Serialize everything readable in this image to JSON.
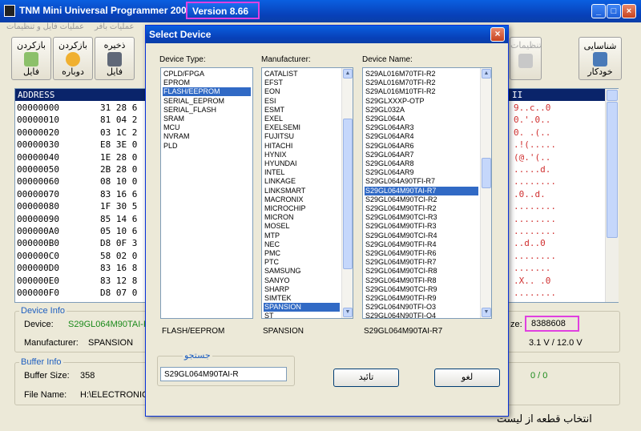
{
  "window": {
    "title": "TNM Mini Universal Programmer 2000+",
    "version": "Version 8.66"
  },
  "menu": {
    "items": [
      "عملیات فایل و تنظیمات",
      "عملیات بافر"
    ]
  },
  "toolbar": {
    "load_file": "بازکردن",
    "load_file2": "فایل",
    "reopen": "بازکردن",
    "reopen2": "دوباره",
    "save": "ذخیره",
    "save2": "فایل",
    "settings": "تنظیمات",
    "detect": "شناسایی",
    "detect2": "خودکار"
  },
  "hex": {
    "header_address": "ADDRESS",
    "header_ascii_tail": "II",
    "rows": [
      {
        "addr": "00000000",
        "hex": "31 28 6",
        "ascii": "9..c..0"
      },
      {
        "addr": "00000010",
        "hex": "81 04 2",
        "ascii": "0.'.0.."
      },
      {
        "addr": "00000020",
        "hex": "03 1C 2",
        "ascii": "0. .(.."
      },
      {
        "addr": "00000030",
        "hex": "E8 3E 0",
        "ascii": ".!(....."
      },
      {
        "addr": "00000040",
        "hex": "1E 28 0",
        "ascii": "(@.'(.."
      },
      {
        "addr": "00000050",
        "hex": "2B 28 0",
        "ascii": ".....d."
      },
      {
        "addr": "00000060",
        "hex": "08 10 0",
        "ascii": "........"
      },
      {
        "addr": "00000070",
        "hex": "83 16 6",
        "ascii": ".0..d."
      },
      {
        "addr": "00000080",
        "hex": "1F 30 5",
        "ascii": "........"
      },
      {
        "addr": "00000090",
        "hex": "85 14 6",
        "ascii": "........"
      },
      {
        "addr": "000000A0",
        "hex": "05 10 6",
        "ascii": "........"
      },
      {
        "addr": "000000B0",
        "hex": "D8 0F 3",
        "ascii": "..d..0"
      },
      {
        "addr": "000000C0",
        "hex": "58 02 0",
        "ascii": "........"
      },
      {
        "addr": "000000D0",
        "hex": "83 16 8",
        "ascii": "......."
      },
      {
        "addr": "000000E0",
        "hex": "83 12 8",
        "ascii": ".X.. .0"
      },
      {
        "addr": "000000F0",
        "hex": "D8 07 0",
        "ascii": "........"
      }
    ]
  },
  "device_info": {
    "group_label": "Device Info",
    "device_label": "Device:",
    "device_value": "S29GL064M90TAI-R",
    "manufacturer_label": "Manufacturer:",
    "manufacturer_value": "SPANSION",
    "size_label": "ze:",
    "size_value": "8388608",
    "voltage_value": "3.1 V / 12.0 V"
  },
  "buffer_info": {
    "group_label": "Buffer Info",
    "buffer_size_label": "Buffer Size:",
    "buffer_size_value": "358",
    "file_name_label": "File Name:",
    "file_name_value": "H:\\ELECTRONIC",
    "counter": "0 / 0"
  },
  "status_text": "انتخاب قطعه از لیست",
  "dialog": {
    "title": "Select Device",
    "device_type_label": "Device Type:",
    "manufacturer_label": "Manufacturer:",
    "device_name_label": "Device Name:",
    "device_types": [
      "CPLD/FPGA",
      "EPROM",
      "FLASH/EEPROM",
      "SERIAL_EEPROM",
      "SERIAL_FLASH",
      "SRAM",
      "MCU",
      "NVRAM",
      "PLD"
    ],
    "selected_type_index": 2,
    "manufacturers": [
      "CATALIST",
      "EFST",
      "EON",
      "ESI",
      "ESMT",
      "EXEL",
      "EXELSEMI",
      "FUJITSU",
      "HITACHI",
      "HYNIX",
      "HYUNDAI",
      "INTEL",
      "LINKAGE",
      "LINKSMART",
      "MACRONIX",
      "MICROCHIP",
      "MICRON",
      "MOSEL",
      "MTP",
      "NEC",
      "PMC",
      "PTC",
      "SAMSUNG",
      "SANYO",
      "SHARP",
      "SIMTEK",
      "SPANSION",
      "ST"
    ],
    "selected_manufacturer_index": 26,
    "device_names": [
      "S29AL016M70TFI-R2",
      "S29AL016M70TFI-R2",
      "S29AL016M10TFI-R2",
      "S29GLXXXP-OTP",
      "S29GL032A",
      "S29GL064A",
      "S29GL064AR3",
      "S29GL064AR4",
      "S29GL064AR6",
      "S29GL064AR7",
      "S29GL064AR8",
      "S29GL064AR9",
      "S29GL064A90TFI-R7",
      "S29GL064M90TAI-R7",
      "S29GL064M90TCI-R2",
      "S29GL064M90TFI-R2",
      "S29GL064M90TCI-R3",
      "S29GL064M90TFI-R3",
      "S29GL064M90TCI-R4",
      "S29GL064M90TFI-R4",
      "S29GL064M90TFI-R6",
      "S29GL064M90TFI-R7",
      "S29GL064M90TCI-R8",
      "S29GL064M90TFI-R8",
      "S29GL064M90TCI-R9",
      "S29GL064M90TFI-R9",
      "S29GL064N90TFI-O3",
      "S29GL064N90TFI-O4"
    ],
    "selected_name_index": 13,
    "selected_type_text": "FLASH/EEPROM",
    "selected_manufacturer_text": "SPANSION",
    "selected_name_text": "S29GL064M90TAI-R7",
    "search_label": "جستجو",
    "search_value": "S29GL064M90TAI-R",
    "ok_label": "تائید",
    "cancel_label": "لغو"
  },
  "colors": {
    "title_bar": "#0a48c8",
    "selection": "#316ac5",
    "highlight_border": "#e040e0",
    "hex_header": "#0a246a",
    "ascii_text": "#d03030"
  }
}
